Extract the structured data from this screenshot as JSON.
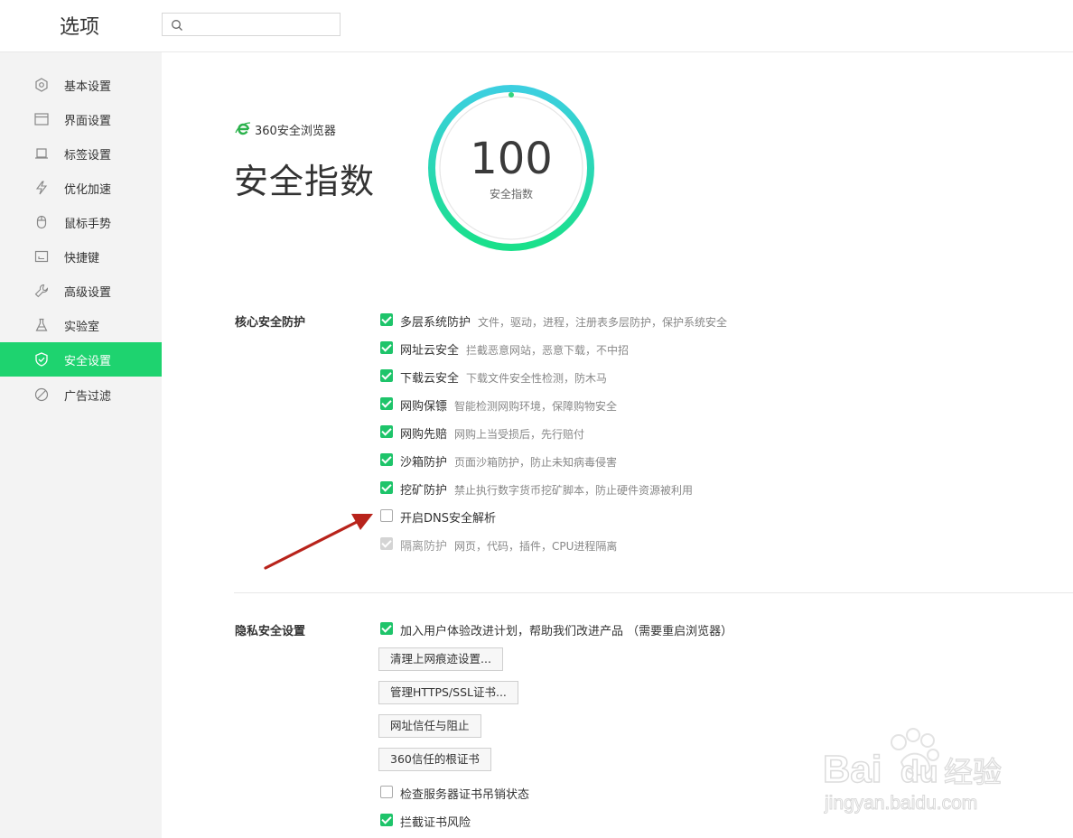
{
  "header": {
    "title": "选项",
    "search_placeholder": ""
  },
  "sidebar": {
    "items": [
      {
        "label": "基本设置",
        "icon": "gear-icon"
      },
      {
        "label": "界面设置",
        "icon": "window-icon"
      },
      {
        "label": "标签设置",
        "icon": "tab-icon"
      },
      {
        "label": "优化加速",
        "icon": "lightning-icon"
      },
      {
        "label": "鼠标手势",
        "icon": "mouse-icon"
      },
      {
        "label": "快捷键",
        "icon": "keyboard-icon"
      },
      {
        "label": "高级设置",
        "icon": "wrench-icon"
      },
      {
        "label": "实验室",
        "icon": "flask-icon"
      },
      {
        "label": "安全设置",
        "icon": "shield-icon",
        "active": true
      },
      {
        "label": "广告过滤",
        "icon": "block-icon"
      }
    ]
  },
  "brand": {
    "name": "360安全浏览器",
    "logo_color": "#2bb24c"
  },
  "main": {
    "title": "安全指数",
    "score": "100",
    "score_label": "安全指数",
    "gauge": {
      "level": 1.0,
      "color_start": "#3ccfe0",
      "color_end": "#19e08a"
    }
  },
  "core": {
    "title": "核心安全防护",
    "options": [
      {
        "label": "多层系统防护",
        "desc": "文件，驱动，进程，注册表多层防护，保护系统安全",
        "state": "checked"
      },
      {
        "label": "网址云安全",
        "desc": "拦截恶意网站，恶意下载，不中招",
        "state": "checked"
      },
      {
        "label": "下载云安全",
        "desc": "下载文件安全性检测，防木马",
        "state": "checked"
      },
      {
        "label": "网购保镖",
        "desc": "智能检测网购环境，保障购物安全",
        "state": "checked"
      },
      {
        "label": "网购先赔",
        "desc": "网购上当受损后，先行赔付",
        "state": "checked"
      },
      {
        "label": "沙箱防护",
        "desc": "页面沙箱防护，防止未知病毒侵害",
        "state": "checked"
      },
      {
        "label": "挖矿防护",
        "desc": "禁止执行数字货币挖矿脚本，防止硬件资源被利用",
        "state": "checked"
      },
      {
        "label": "开启DNS安全解析",
        "desc": "",
        "state": "unchecked"
      },
      {
        "label": "隔离防护",
        "desc": "网页，代码，插件，CPU进程隔离",
        "state": "disabled"
      }
    ]
  },
  "privacy": {
    "title": "隐私安全设置",
    "experience": {
      "label": "加入用户体验改进计划，帮助我们改进产品 （需要重启浏览器）",
      "state": "checked"
    },
    "buttons": [
      "清理上网痕迹设置...",
      "管理HTTPS/SSL证书...",
      "网址信任与阻止",
      "360信任的根证书"
    ],
    "options": [
      {
        "label": "检查服务器证书吊销状态",
        "state": "unchecked"
      },
      {
        "label": "拦截证书风险",
        "state": "checked"
      }
    ]
  },
  "watermark": {
    "line1": "Bai",
    "line2": "du",
    "line3": "经验",
    "url": "jingyan.baidu.com"
  },
  "colors": {
    "accent": "#1ed36f",
    "checkbox": "#1ec46a",
    "arrow": "#b8231b"
  }
}
